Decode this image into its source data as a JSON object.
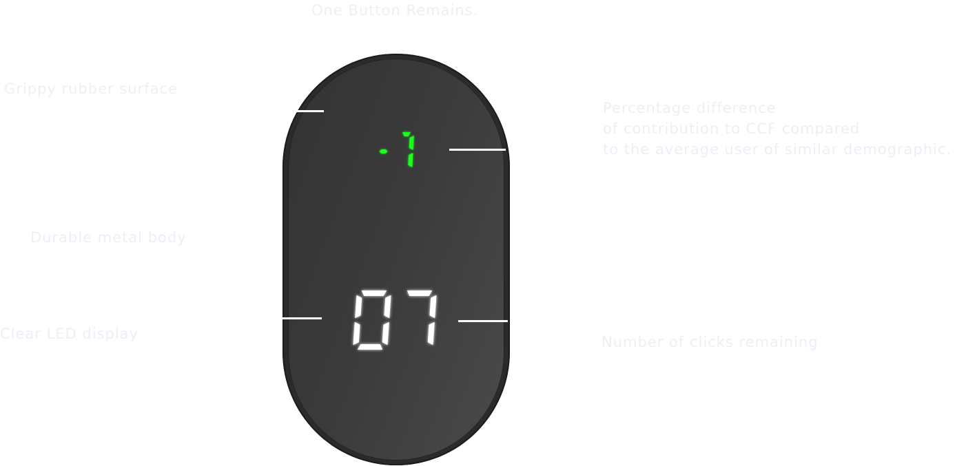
{
  "captions": {
    "title": "One Button Remains.",
    "grip": "Grippy rubber surface",
    "percentage": [
      "Percentage difference",
      "of contribution to CCF compared",
      "to the average user of similar demographic."
    ],
    "body": "Durable metal body",
    "led": "Clear LED display",
    "clicks": "Number of clicks remaining"
  },
  "device": {
    "percentage_display": "-7",
    "clicks_display": "07",
    "colors": {
      "percentage_digits": "#1aff1a",
      "clicks_digits": "#ffffff",
      "body": "#2b2b2b",
      "face": "#3a3a3a"
    }
  }
}
